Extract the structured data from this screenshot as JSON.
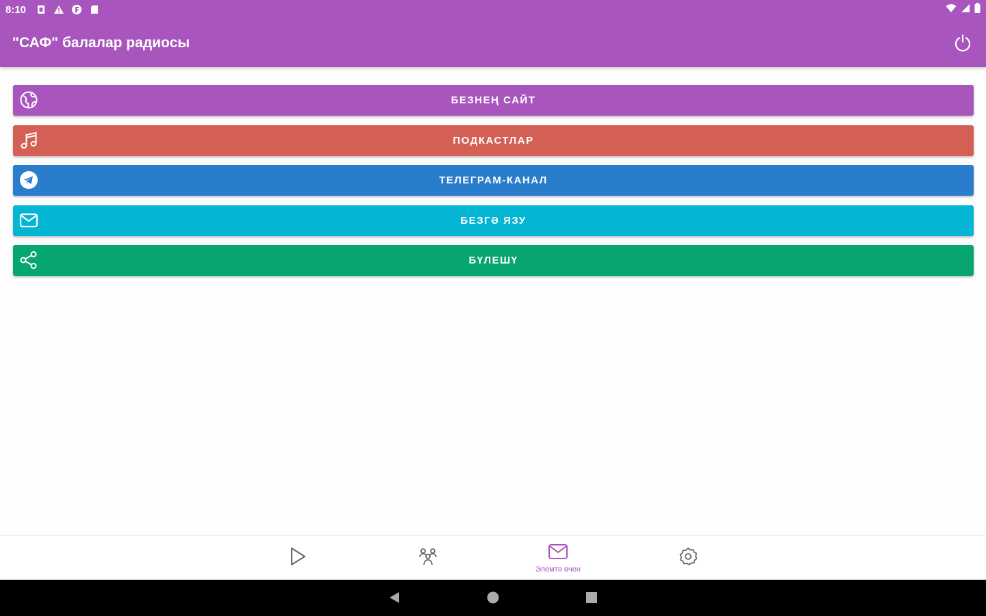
{
  "status_bar": {
    "time": "8:10",
    "left_icons": [
      "sim-icon",
      "warning-icon",
      "app-notification-icon",
      "sd-card-icon"
    ],
    "right_icons": [
      "wifi-icon",
      "signal-icon",
      "battery-icon"
    ]
  },
  "app_bar": {
    "title": "\"САФ\" балалар радиосы",
    "power_icon": "power-icon"
  },
  "actions": [
    {
      "label": "БЕЗНЕҢ САЙТ",
      "icon": "globe-icon",
      "color": "#a855be"
    },
    {
      "label": "ПОДКАСТЛАР",
      "icon": "music-icon",
      "color": "#d45f55"
    },
    {
      "label": "ТЕЛЕГРАМ-КАНАЛ",
      "icon": "telegram-icon",
      "color": "#2a7dcc"
    },
    {
      "label": "БЕЗГӘ ЯЗУ",
      "icon": "mail-icon",
      "color": "#05b6d4"
    },
    {
      "label": "БҮЛЕШҮ",
      "icon": "share-icon",
      "color": "#07a572"
    }
  ],
  "bottom_nav": {
    "items": [
      {
        "icon": "play-icon",
        "label": ""
      },
      {
        "icon": "people-icon",
        "label": ""
      },
      {
        "icon": "mail-icon",
        "label": "Элемтә өчен",
        "active": true
      },
      {
        "icon": "settings-icon",
        "label": ""
      }
    ],
    "active_color": "#a855be"
  },
  "system_nav": [
    "back-icon",
    "home-icon",
    "recents-icon"
  ]
}
